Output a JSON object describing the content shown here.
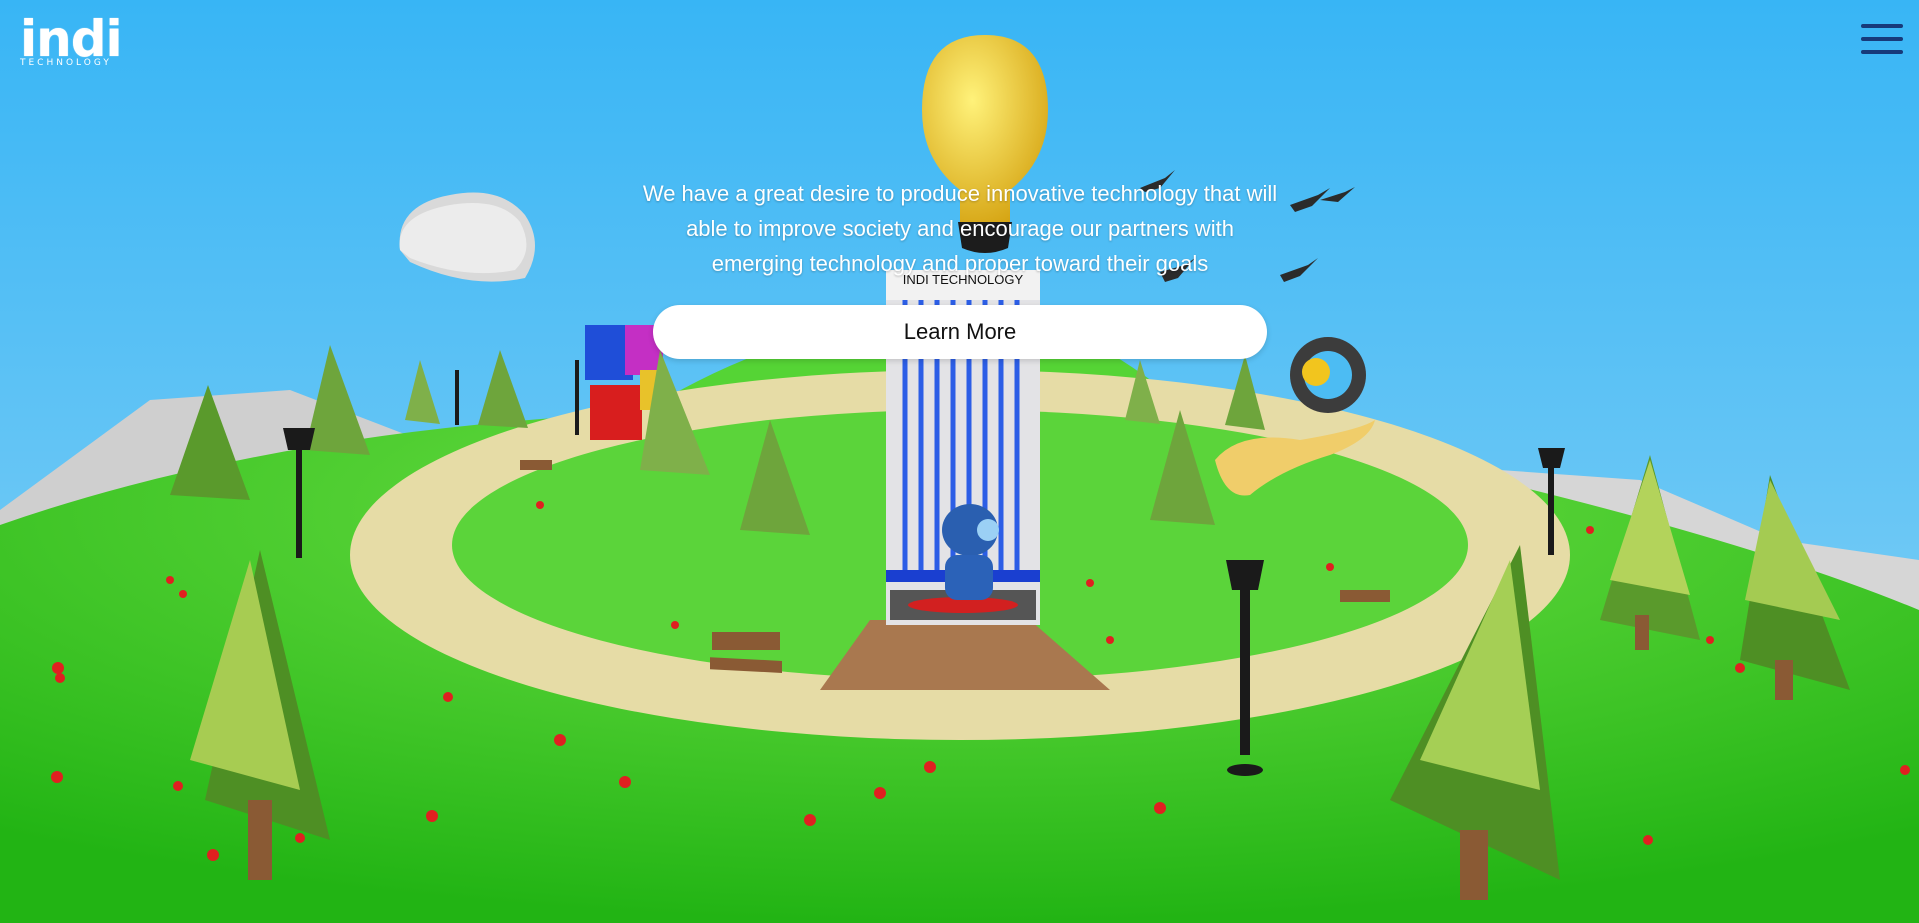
{
  "header": {
    "logo_text": "indi",
    "logo_subtext": "TECHNOLOGY"
  },
  "hero": {
    "description": "We have a great desire to produce innovative technology that will able to improve society and encourage our partners with emerging technology and proper toward their goals",
    "cta_label": "Learn More"
  },
  "scene": {
    "building_sign": "INDI TECHNOLOGY"
  },
  "colors": {
    "sky": "#4cbcf3",
    "grass": "#3fd12a",
    "path": "#e8dfa8",
    "menu_icon": "#173a7a",
    "building_stripes": "#1e4fd8"
  }
}
